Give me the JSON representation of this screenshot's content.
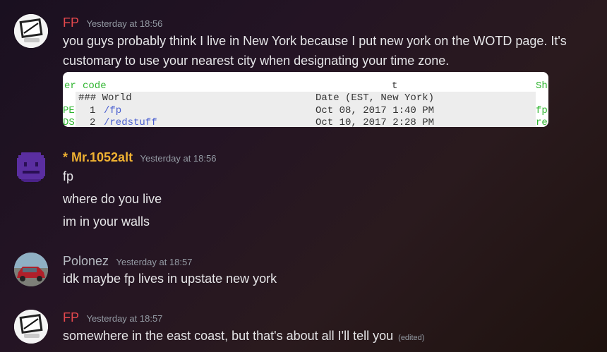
{
  "messages": [
    {
      "author": "FP",
      "timestamp": "Yesterday at 18:56",
      "lines": [
        "you guys probably think I live in New York because I put new york on the WOTD page. It's",
        "customary to use your nearest city when designating your time zone."
      ],
      "embed": {
        "left_col": [
          "er",
          "PE",
          "DS"
        ],
        "header_code": "code",
        "header_t": "t",
        "right_col": [
          "Sh",
          "fp",
          "re"
        ],
        "table_head": "### World",
        "table_date_head": "Date (EST, New York)",
        "rows": [
          {
            "num": "1",
            "name": "/fp",
            "date": "Oct 08, 2017 1:40 PM"
          },
          {
            "num": "2",
            "name": "/redstuff",
            "date": "Oct 10, 2017 2:28 PM"
          }
        ]
      }
    },
    {
      "author": "* Mr.1052alt",
      "timestamp": "Yesterday at 18:56",
      "lines": [
        "fp",
        "where do you live",
        "im in your walls"
      ]
    },
    {
      "author": "Polonez",
      "timestamp": "Yesterday at 18:57",
      "lines": [
        "idk maybe fp lives in upstate new york"
      ]
    },
    {
      "author": "FP",
      "timestamp": "Yesterday at 18:57",
      "lines": [
        "somewhere in the east coast, but that's about all I'll tell you"
      ],
      "edited": "(edited)"
    }
  ],
  "colors": {
    "fp_name": "#e5484d",
    "mr_name": "#f0b232",
    "polonez_name": "#b5bac1",
    "timestamp": "#949ba4"
  }
}
